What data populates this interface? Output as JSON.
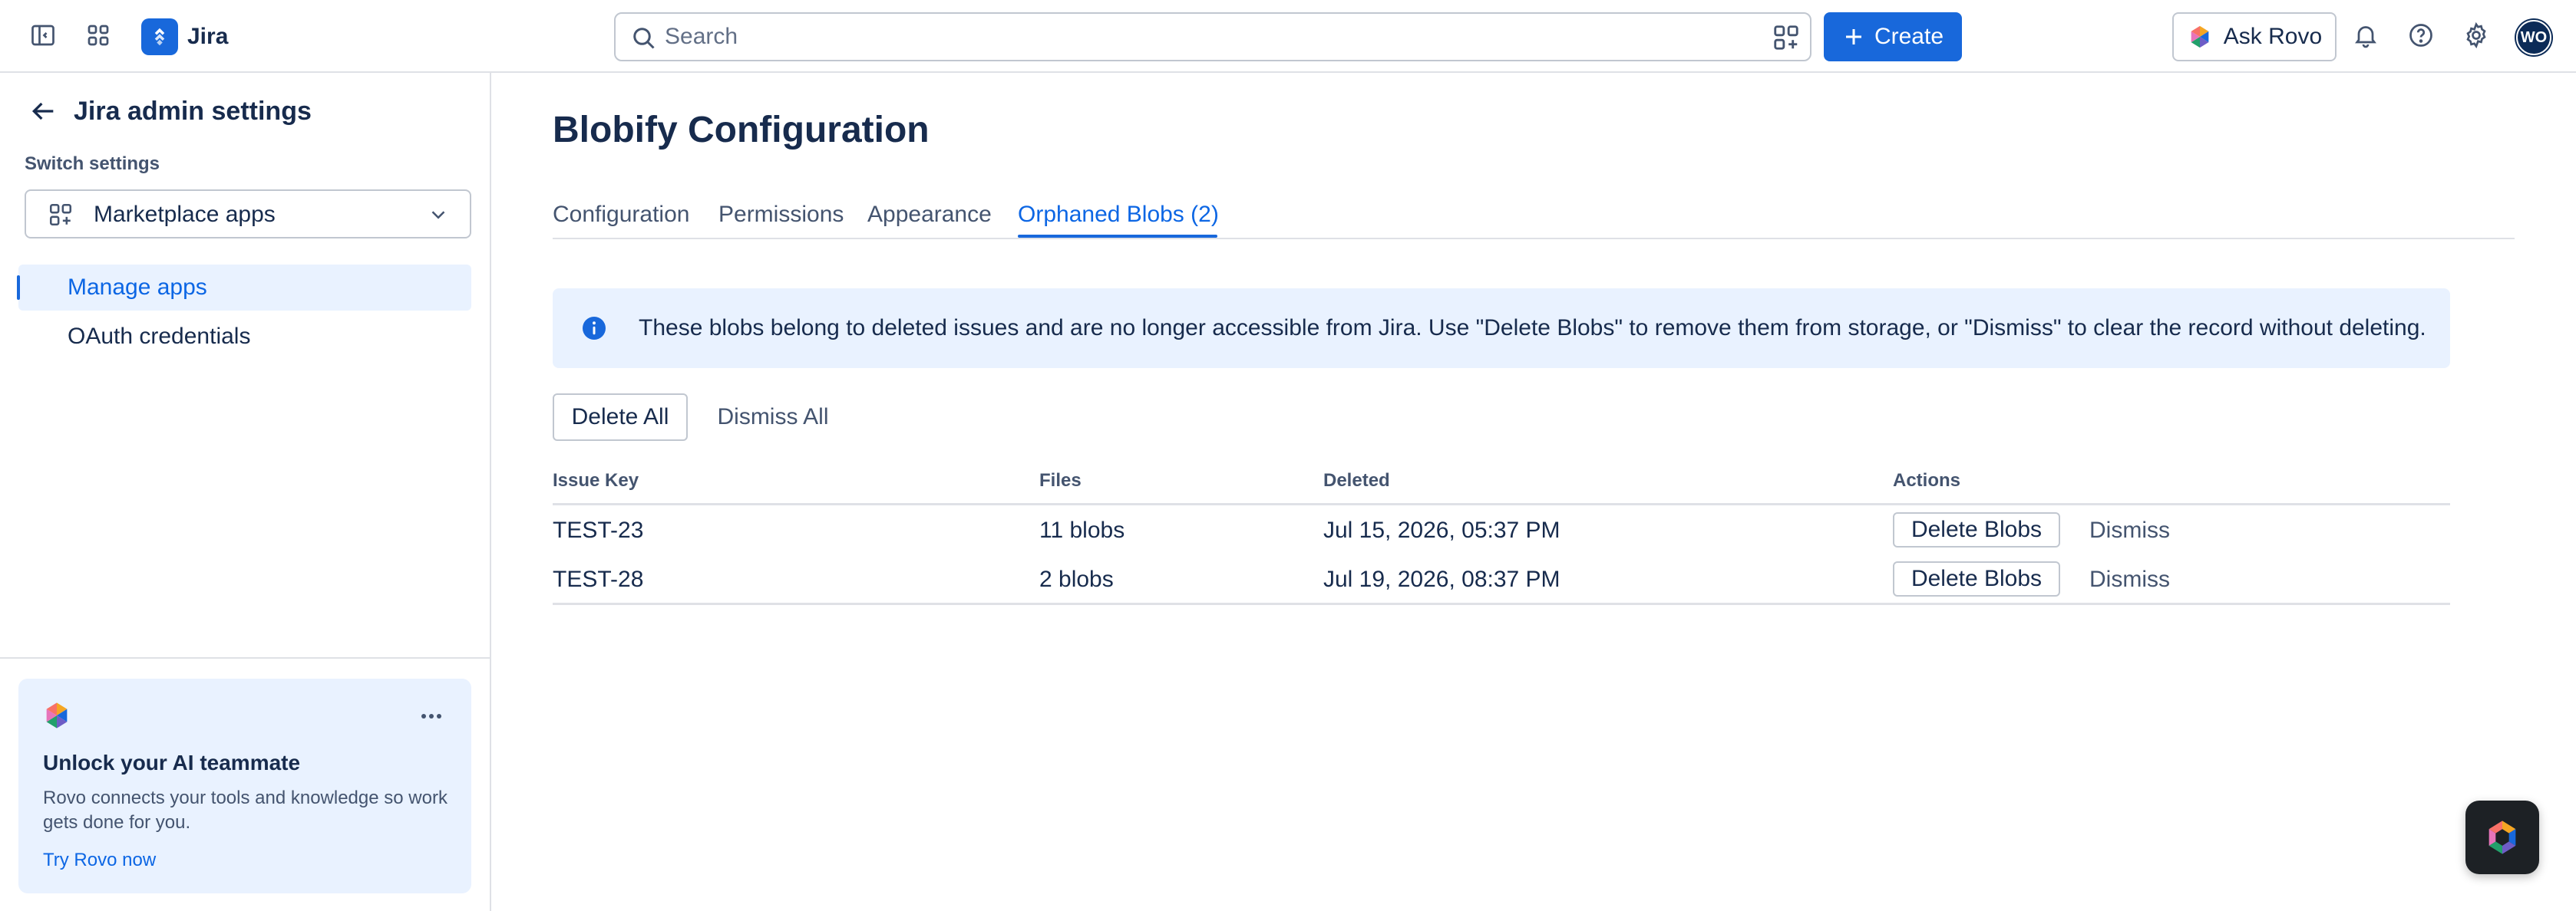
{
  "topbar": {
    "app_name": "Jira",
    "search_placeholder": "Search",
    "create_label": "Create",
    "ask_rovo_label": "Ask Rovo",
    "avatar_initials": "WO"
  },
  "sidebar": {
    "title": "Jira admin settings",
    "switch_label": "Switch settings",
    "switch_value": "Marketplace apps",
    "nav_items": [
      {
        "label": "Manage apps",
        "active": true
      },
      {
        "label": "OAuth credentials",
        "active": false
      }
    ],
    "promo": {
      "title": "Unlock your AI teammate",
      "description": "Rovo connects your tools and knowledge so work gets done for you.",
      "link": "Try Rovo now"
    }
  },
  "main": {
    "title": "Blobify Configuration",
    "tabs": [
      {
        "label": "Configuration",
        "active": false
      },
      {
        "label": "Permissions",
        "active": false
      },
      {
        "label": "Appearance",
        "active": false
      },
      {
        "label": "Orphaned Blobs (2)",
        "active": true
      }
    ],
    "banner": "These blobs belong to deleted issues and are no longer accessible from Jira. Use \"Delete Blobs\" to remove them from storage, or \"Dismiss\" to clear the record without deleting.",
    "delete_all_label": "Delete All",
    "dismiss_all_label": "Dismiss All",
    "table": {
      "headers": [
        "Issue Key",
        "Files",
        "Deleted",
        "Actions"
      ],
      "rows": [
        {
          "issue_key": "TEST-23",
          "files": "11 blobs",
          "deleted": "Jul 15, 2026, 05:37 PM",
          "action_primary": "Delete Blobs",
          "action_secondary": "Dismiss"
        },
        {
          "issue_key": "TEST-28",
          "files": "2 blobs",
          "deleted": "Jul 19, 2026, 08:37 PM",
          "action_primary": "Delete Blobs",
          "action_secondary": "Dismiss"
        }
      ]
    }
  },
  "colors": {
    "brand": "#1868db",
    "banner_bg": "#e9f2ff",
    "text": "#172b4d"
  }
}
